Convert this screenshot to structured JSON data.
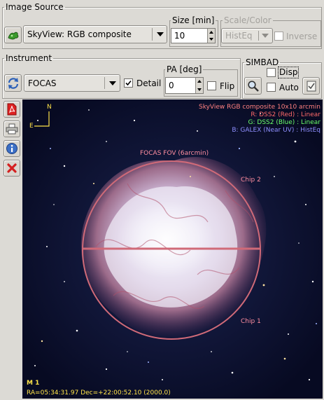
{
  "image_source": {
    "title": "Image Source",
    "survey_icon": "sky-survey-icon",
    "survey_selected": "SkyView: RGB composite",
    "size_label": "Size [min]",
    "size_value": "10",
    "scale_color_label": "Scale/Color",
    "scale_value": "HistEq",
    "inverse_label": "Inverse"
  },
  "instrument": {
    "title": "Instrument",
    "refresh_icon": "refresh-icon",
    "selected": "FOCAS",
    "detail_label": "Detail",
    "detail_checked": true,
    "pa_label": "PA [deg]",
    "pa_value": "0",
    "flip_label": "Flip"
  },
  "simbad": {
    "title": "SIMBAD",
    "search_icon": "magnifier-icon",
    "disp_label": "Disp",
    "auto_label": "Auto",
    "list_icon": "catalog-list-icon"
  },
  "side_toolbar": [
    "pdf-icon",
    "print-icon",
    "info-icon",
    "close-icon"
  ],
  "sky_view": {
    "compass_n": "N",
    "compass_e": "E",
    "info_lines": [
      {
        "text": "SkyView RGB composite  10x10 arcmin",
        "color": "#ff8080"
      },
      {
        "text": "R: DSS2 (Red) : Linear",
        "color": "#ff6a6a"
      },
      {
        "text": "G: DSS2 (Blue) : Linear",
        "color": "#6aff6a"
      },
      {
        "text": "B: GALEX (Near UV) : HistEq",
        "color": "#8f8fff"
      }
    ],
    "fov_label": "FOCAS FOV (6arcmin)",
    "chip2_label": "Chip 2",
    "chip1_label": "Chip 1",
    "object_name": "M 1",
    "coords": "RA=05:34:31.97  Dec=+22:00:52.10 (2000.0)",
    "overlay_color": "#d06a78"
  }
}
